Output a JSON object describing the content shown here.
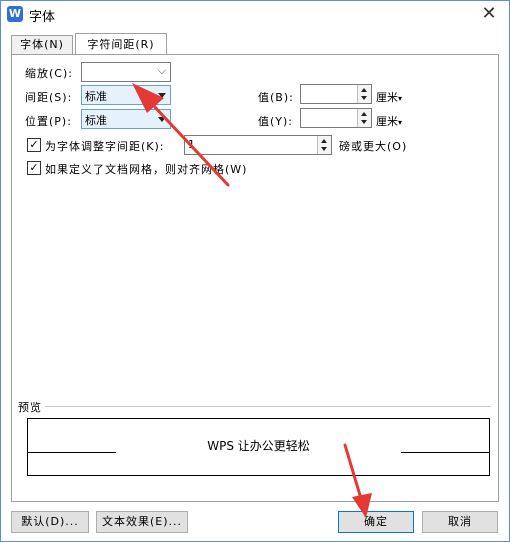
{
  "window": {
    "title": "字体",
    "app_icon_letter": "W",
    "close": "✕"
  },
  "tabs": [
    {
      "label": "字体(N)",
      "active": false
    },
    {
      "label": "字符间距(R)",
      "active": true
    }
  ],
  "fields": {
    "scale": {
      "label": "缩放(C):",
      "value": ""
    },
    "spacing": {
      "label": "间距(S):",
      "value": "标准",
      "by_label": "值(B):",
      "by_value": "",
      "by_unit": "厘米"
    },
    "position": {
      "label": "位置(P):",
      "value": "标准",
      "by_label": "值(Y):",
      "by_value": "",
      "by_unit": "厘米"
    }
  },
  "kerning": {
    "checked": true,
    "label": "为字体调整字间距(K):",
    "value": "1",
    "suffix": "磅或更大(O)"
  },
  "snap_grid": {
    "checked": true,
    "label": "如果定义了文档网格，则对齐网格(W)"
  },
  "preview": {
    "legend": "预览",
    "text": "WPS 让办公更轻松"
  },
  "buttons": {
    "default": "默认(D)...",
    "text_effect": "文本效果(E)...",
    "ok": "确定",
    "cancel": "取消"
  },
  "colors": {
    "accent": "#0078d7",
    "annotation": "#e53935"
  }
}
